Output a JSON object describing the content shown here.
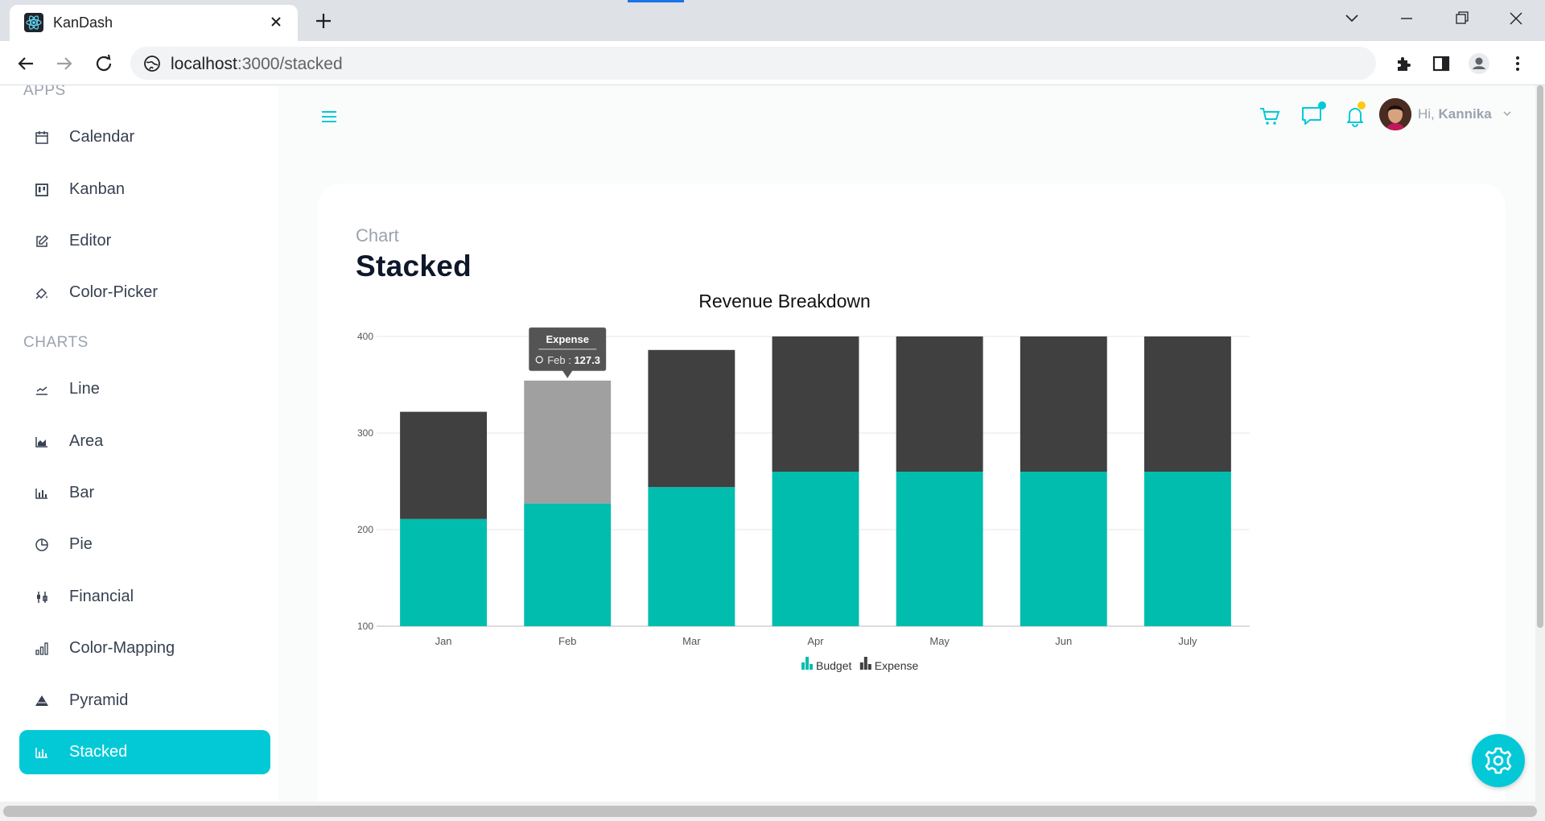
{
  "browser": {
    "tab_title": "KanDash",
    "url_host": "localhost",
    "url_path": ":3000/stacked"
  },
  "sidebar": {
    "sections": [
      {
        "title": "APPS",
        "items": [
          {
            "label": "Calendar",
            "icon": "calendar-icon"
          },
          {
            "label": "Kanban",
            "icon": "kanban-icon"
          },
          {
            "label": "Editor",
            "icon": "edit-icon"
          },
          {
            "label": "Color-Picker",
            "icon": "color-picker-icon"
          }
        ]
      },
      {
        "title": "CHARTS",
        "items": [
          {
            "label": "Line",
            "icon": "line-chart-icon"
          },
          {
            "label": "Area",
            "icon": "area-chart-icon"
          },
          {
            "label": "Bar",
            "icon": "bar-chart-icon"
          },
          {
            "label": "Pie",
            "icon": "pie-chart-icon"
          },
          {
            "label": "Financial",
            "icon": "financial-icon"
          },
          {
            "label": "Color-Mapping",
            "icon": "color-mapping-icon"
          },
          {
            "label": "Pyramid",
            "icon": "pyramid-icon"
          },
          {
            "label": "Stacked",
            "icon": "stacked-icon",
            "active": true
          }
        ]
      }
    ]
  },
  "header": {
    "greeting": "Hi,",
    "user_name": "Kannika",
    "accent_color": "#03c9d7"
  },
  "page": {
    "category": "Chart",
    "title": "Stacked"
  },
  "chart_data": {
    "type": "bar",
    "stacked": true,
    "title": "Revenue Breakdown",
    "categories": [
      "Jan",
      "Feb",
      "Mar",
      "Apr",
      "May",
      "Jun",
      "July"
    ],
    "series": [
      {
        "name": "Budget",
        "color": "#00bdae",
        "values": [
          111,
          127,
          144,
          160,
          160,
          160,
          160
        ]
      },
      {
        "name": "Expense",
        "color": "#404041",
        "values": [
          111,
          127.3,
          142,
          160,
          160,
          160,
          160
        ]
      }
    ],
    "ylim": [
      100,
      400
    ],
    "yticks": [
      100,
      200,
      300,
      400
    ],
    "grid": true,
    "legend_position": "bottom",
    "tooltip": {
      "series": "Expense",
      "category": "Feb",
      "value": "127.3",
      "separator": " : "
    },
    "highlight_color": "#a0a0a0"
  }
}
